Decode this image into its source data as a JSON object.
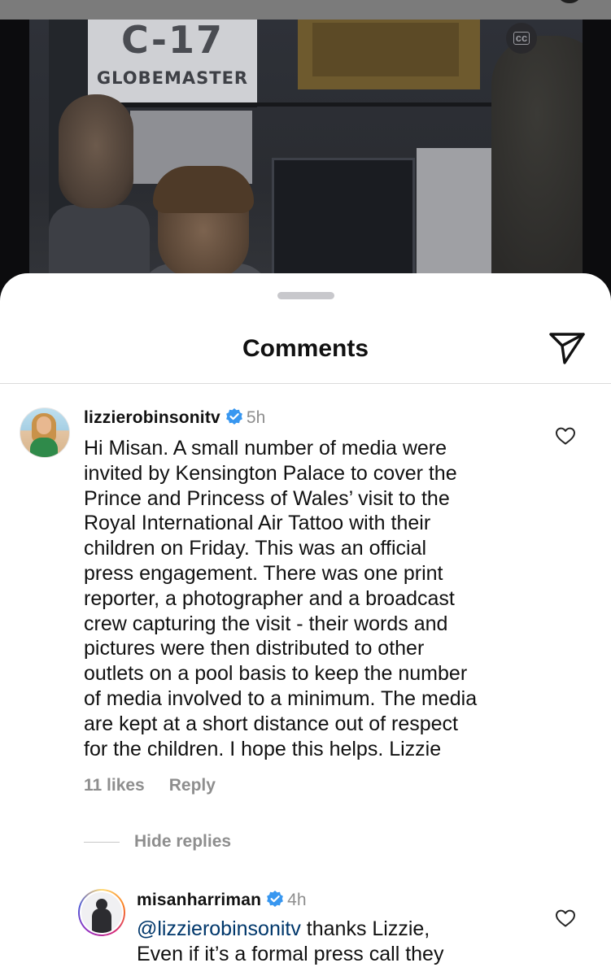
{
  "video": {
    "sign_title": "C-17",
    "sign_subtitle": "GLOBEMASTER",
    "captions_badge": "cc"
  },
  "sheet": {
    "title": "Comments",
    "share_icon": "paper-plane-icon"
  },
  "comments": [
    {
      "username": "lizzierobinsonitv",
      "verified": true,
      "time": "5h",
      "text": "Hi Misan. A small number of media were\ninvited by Kensington Palace to cover the\nPrince and Princess of Wales’ visit to the\nRoyal International Air Tattoo with their\nchildren on Friday. This was an official\npress engagement. There was one print\nreporter, a photographer and a broadcast\ncrew capturing the visit - their words and\npictures were then distributed to other\noutlets on a pool basis to keep the number\nof media involved to a minimum. The media\nare kept at a short distance out of respect\nfor the children. I hope this helps. Lizzie",
      "likes": "11 likes",
      "reply_label": "Reply",
      "like_icon": "heart-outline-icon"
    }
  ],
  "replies_toggle": "Hide replies",
  "replies": [
    {
      "username": "misanharriman",
      "verified": true,
      "time": "4h",
      "mention": "@lizzierobinsonitv",
      "text_after_mention": " thanks Lizzie,",
      "text_line2": "Even if it’s a formal press call they",
      "like_icon": "heart-outline-icon"
    }
  ],
  "colors": {
    "link": "#00376b",
    "secondary_text": "#8e8e8e",
    "verified_badge": "#3897f0"
  }
}
